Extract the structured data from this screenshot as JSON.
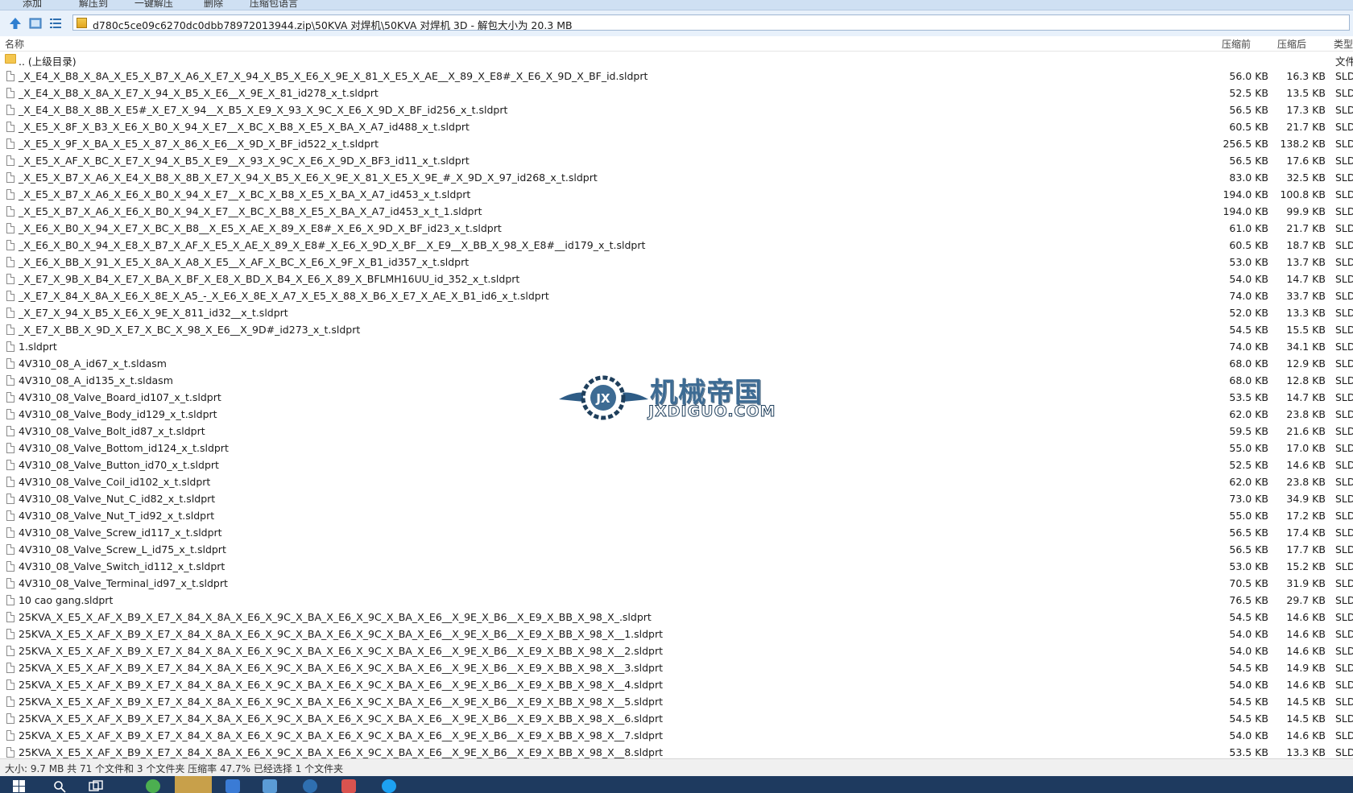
{
  "toolbar": {
    "items": [
      "添加",
      "解压到",
      "一键解压",
      "删除",
      "压缩包语言"
    ]
  },
  "address": {
    "path": "d780c5ce09c6270dc0dbb78972013944.zip\\50KVA 对焊机\\50KVA 对焊机 3D - 解包大小为 20.3 MB"
  },
  "columns": {
    "name": "名称",
    "packed": "压缩前",
    "unpacked": "压缩后",
    "type": "类型"
  },
  "parent_dir": {
    "name": ".. (上级目录)",
    "type": "文件"
  },
  "files": [
    {
      "name": "_X_E4_X_B8_X_8A_X_E5_X_B7_X_A6_X_E7_X_94_X_B5_X_E6_X_9E_X_81_X_E5_X_AE__X_89_X_E8#_X_E6_X_9D_X_BF_id.sldprt",
      "packed": "56.0 KB",
      "unpacked": "16.3 KB",
      "type": "SLD"
    },
    {
      "name": "_X_E4_X_B8_X_8A_X_E7_X_94_X_B5_X_E6__X_9E_X_81_id278_x_t.sldprt",
      "packed": "52.5 KB",
      "unpacked": "13.5 KB",
      "type": "SLD"
    },
    {
      "name": "_X_E4_X_B8_X_8B_X_E5#_X_E7_X_94__X_B5_X_E9_X_93_X_9C_X_E6_X_9D_X_BF_id256_x_t.sldprt",
      "packed": "56.5 KB",
      "unpacked": "17.3 KB",
      "type": "SLD"
    },
    {
      "name": "_X_E5_X_8F_X_B3_X_E6_X_B0_X_94_X_E7__X_BC_X_B8_X_E5_X_BA_X_A7_id488_x_t.sldprt",
      "packed": "60.5 KB",
      "unpacked": "21.7 KB",
      "type": "SLD"
    },
    {
      "name": "_X_E5_X_9F_X_BA_X_E5_X_87_X_86_X_E6__X_9D_X_BF_id522_x_t.sldprt",
      "packed": "256.5 KB",
      "unpacked": "138.2 KB",
      "type": "SLD"
    },
    {
      "name": "_X_E5_X_AF_X_BC_X_E7_X_94_X_B5_X_E9__X_93_X_9C_X_E6_X_9D_X_BF3_id11_x_t.sldprt",
      "packed": "56.5 KB",
      "unpacked": "17.6 KB",
      "type": "SLD"
    },
    {
      "name": "_X_E5_X_B7_X_A6_X_E4_X_B8_X_8B_X_E7_X_94_X_B5_X_E6_X_9E_X_81_X_E5_X_9E_#_X_9D_X_97_id268_x_t.sldprt",
      "packed": "83.0 KB",
      "unpacked": "32.5 KB",
      "type": "SLD"
    },
    {
      "name": "_X_E5_X_B7_X_A6_X_E6_X_B0_X_94_X_E7__X_BC_X_B8_X_E5_X_BA_X_A7_id453_x_t.sldprt",
      "packed": "194.0 KB",
      "unpacked": "100.8 KB",
      "type": "SLD"
    },
    {
      "name": "_X_E5_X_B7_X_A6_X_E6_X_B0_X_94_X_E7__X_BC_X_B8_X_E5_X_BA_X_A7_id453_x_t_1.sldprt",
      "packed": "194.0 KB",
      "unpacked": "99.9 KB",
      "type": "SLD"
    },
    {
      "name": "_X_E6_X_B0_X_94_X_E7_X_BC_X_B8__X_E5_X_AE_X_89_X_E8#_X_E6_X_9D_X_BF_id23_x_t.sldprt",
      "packed": "61.0 KB",
      "unpacked": "21.7 KB",
      "type": "SLD"
    },
    {
      "name": "_X_E6_X_B0_X_94_X_E8_X_B7_X_AF_X_E5_X_AE_X_89_X_E8#_X_E6_X_9D_X_BF__X_E9__X_BB_X_98_X_E8#__id179_x_t.sldprt",
      "packed": "60.5 KB",
      "unpacked": "18.7 KB",
      "type": "SLD"
    },
    {
      "name": "_X_E6_X_BB_X_91_X_E5_X_8A_X_A8_X_E5__X_AF_X_BC_X_E6_X_9F_X_B1_id357_x_t.sldprt",
      "packed": "53.0 KB",
      "unpacked": "13.7 KB",
      "type": "SLD"
    },
    {
      "name": "_X_E7_X_9B_X_B4_X_E7_X_BA_X_BF_X_E8_X_BD_X_B4_X_E6_X_89_X_BFLMH16UU_id_352_x_t.sldprt",
      "packed": "54.0 KB",
      "unpacked": "14.7 KB",
      "type": "SLD"
    },
    {
      "name": "_X_E7_X_84_X_8A_X_E6_X_8E_X_A5_-_X_E6_X_8E_X_A7_X_E5_X_88_X_B6_X_E7_X_AE_X_B1_id6_x_t.sldprt",
      "packed": "74.0 KB",
      "unpacked": "33.7 KB",
      "type": "SLD"
    },
    {
      "name": "_X_E7_X_94_X_B5_X_E6_X_9E_X_811_id32__x_t.sldprt",
      "packed": "52.0 KB",
      "unpacked": "13.3 KB",
      "type": "SLD"
    },
    {
      "name": "_X_E7_X_BB_X_9D_X_E7_X_BC_X_98_X_E6__X_9D#_id273_x_t.sldprt",
      "packed": "54.5 KB",
      "unpacked": "15.5 KB",
      "type": "SLD"
    },
    {
      "name": "1.sldprt",
      "packed": "74.0 KB",
      "unpacked": "34.1 KB",
      "type": "SLD"
    },
    {
      "name": "4V310_08_A_id67_x_t.sldasm",
      "packed": "68.0 KB",
      "unpacked": "12.9 KB",
      "type": "SLD"
    },
    {
      "name": "4V310_08_A_id135_x_t.sldasm",
      "packed": "68.0 KB",
      "unpacked": "12.8 KB",
      "type": "SLD"
    },
    {
      "name": "4V310_08_Valve_Board_id107_x_t.sldprt",
      "packed": "53.5 KB",
      "unpacked": "14.7 KB",
      "type": "SLD"
    },
    {
      "name": "4V310_08_Valve_Body_id129_x_t.sldprt",
      "packed": "62.0 KB",
      "unpacked": "23.8 KB",
      "type": "SLD"
    },
    {
      "name": "4V310_08_Valve_Bolt_id87_x_t.sldprt",
      "packed": "59.5 KB",
      "unpacked": "21.6 KB",
      "type": "SLD"
    },
    {
      "name": "4V310_08_Valve_Bottom_id124_x_t.sldprt",
      "packed": "55.0 KB",
      "unpacked": "17.0 KB",
      "type": "SLD"
    },
    {
      "name": "4V310_08_Valve_Button_id70_x_t.sldprt",
      "packed": "52.5 KB",
      "unpacked": "14.6 KB",
      "type": "SLD"
    },
    {
      "name": "4V310_08_Valve_Coil_id102_x_t.sldprt",
      "packed": "62.0 KB",
      "unpacked": "23.8 KB",
      "type": "SLD"
    },
    {
      "name": "4V310_08_Valve_Nut_C_id82_x_t.sldprt",
      "packed": "73.0 KB",
      "unpacked": "34.9 KB",
      "type": "SLD"
    },
    {
      "name": "4V310_08_Valve_Nut_T_id92_x_t.sldprt",
      "packed": "55.0 KB",
      "unpacked": "17.2 KB",
      "type": "SLD"
    },
    {
      "name": "4V310_08_Valve_Screw_id117_x_t.sldprt",
      "packed": "56.5 KB",
      "unpacked": "17.4 KB",
      "type": "SLD"
    },
    {
      "name": "4V310_08_Valve_Screw_L_id75_x_t.sldprt",
      "packed": "56.5 KB",
      "unpacked": "17.7 KB",
      "type": "SLD"
    },
    {
      "name": "4V310_08_Valve_Switch_id112_x_t.sldprt",
      "packed": "53.0 KB",
      "unpacked": "15.2 KB",
      "type": "SLD"
    },
    {
      "name": "4V310_08_Valve_Terminal_id97_x_t.sldprt",
      "packed": "70.5 KB",
      "unpacked": "31.9 KB",
      "type": "SLD"
    },
    {
      "name": "10 cao gang.sldprt",
      "packed": "76.5 KB",
      "unpacked": "29.7 KB",
      "type": "SLD"
    },
    {
      "name": "25KVA_X_E5_X_AF_X_B9_X_E7_X_84_X_8A_X_E6_X_9C_X_BA_X_E6_X_9C_X_BA_X_E6__X_9E_X_B6__X_E9_X_BB_X_98_X_.sldprt",
      "packed": "54.5 KB",
      "unpacked": "14.6 KB",
      "type": "SLD"
    },
    {
      "name": "25KVA_X_E5_X_AF_X_B9_X_E7_X_84_X_8A_X_E6_X_9C_X_BA_X_E6_X_9C_X_BA_X_E6__X_9E_X_B6__X_E9_X_BB_X_98_X__1.sldprt",
      "packed": "54.0 KB",
      "unpacked": "14.6 KB",
      "type": "SLD"
    },
    {
      "name": "25KVA_X_E5_X_AF_X_B9_X_E7_X_84_X_8A_X_E6_X_9C_X_BA_X_E6_X_9C_X_BA_X_E6__X_9E_X_B6__X_E9_X_BB_X_98_X__2.sldprt",
      "packed": "54.0 KB",
      "unpacked": "14.6 KB",
      "type": "SLD"
    },
    {
      "name": "25KVA_X_E5_X_AF_X_B9_X_E7_X_84_X_8A_X_E6_X_9C_X_BA_X_E6_X_9C_X_BA_X_E6__X_9E_X_B6__X_E9_X_BB_X_98_X__3.sldprt",
      "packed": "54.5 KB",
      "unpacked": "14.9 KB",
      "type": "SLD"
    },
    {
      "name": "25KVA_X_E5_X_AF_X_B9_X_E7_X_84_X_8A_X_E6_X_9C_X_BA_X_E6_X_9C_X_BA_X_E6__X_9E_X_B6__X_E9_X_BB_X_98_X__4.sldprt",
      "packed": "54.0 KB",
      "unpacked": "14.6 KB",
      "type": "SLD"
    },
    {
      "name": "25KVA_X_E5_X_AF_X_B9_X_E7_X_84_X_8A_X_E6_X_9C_X_BA_X_E6_X_9C_X_BA_X_E6__X_9E_X_B6__X_E9_X_BB_X_98_X__5.sldprt",
      "packed": "54.5 KB",
      "unpacked": "14.5 KB",
      "type": "SLD"
    },
    {
      "name": "25KVA_X_E5_X_AF_X_B9_X_E7_X_84_X_8A_X_E6_X_9C_X_BA_X_E6_X_9C_X_BA_X_E6__X_9E_X_B6__X_E9_X_BB_X_98_X__6.sldprt",
      "packed": "54.5 KB",
      "unpacked": "14.5 KB",
      "type": "SLD"
    },
    {
      "name": "25KVA_X_E5_X_AF_X_B9_X_E7_X_84_X_8A_X_E6_X_9C_X_BA_X_E6_X_9C_X_BA_X_E6__X_9E_X_B6__X_E9_X_BB_X_98_X__7.sldprt",
      "packed": "54.0 KB",
      "unpacked": "14.6 KB",
      "type": "SLD"
    },
    {
      "name": "25KVA_X_E5_X_AF_X_B9_X_E7_X_84_X_8A_X_E6_X_9C_X_BA_X_E6_X_9C_X_BA_X_E6__X_9E_X_B6__X_E9_X_BB_X_98_X__8.sldprt",
      "packed": "53.5 KB",
      "unpacked": "13.3 KB",
      "type": "SLD"
    }
  ],
  "watermark": {
    "cn": "机械帝国",
    "en": "JXDIGUO.COM"
  },
  "status": {
    "text": "大小: 9.7 MB 共 71 个文件和 3 个文件夹 压缩率 47.7% 已经选择 1 个文件夹"
  },
  "colors": {
    "toolbar_bg": "#cfe0f3",
    "folder": "#f4c64e",
    "taskbar": "#1e3a5f",
    "watermark_blue": "#3d6b93"
  }
}
